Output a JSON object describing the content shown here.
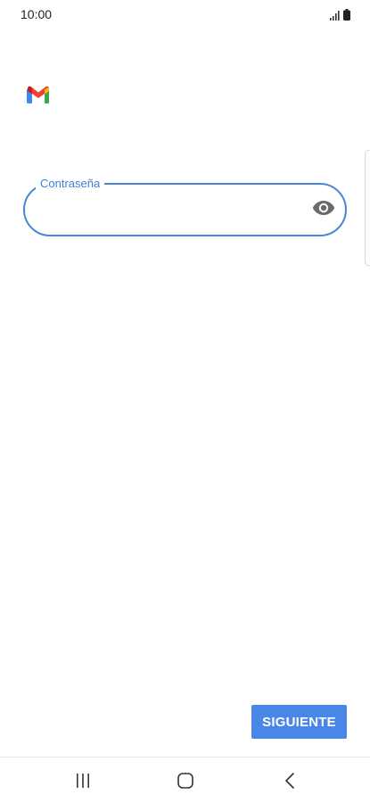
{
  "status_bar": {
    "time": "10:00",
    "icons": [
      "signal-icon",
      "battery-icon"
    ]
  },
  "app": {
    "logo": "gmail-logo-icon"
  },
  "password_field": {
    "label": "Contraseña",
    "value": "",
    "icon": "eye-icon"
  },
  "actions": {
    "next_label": "SIGUIENTE"
  },
  "nav_bar": {
    "icons": [
      "recents-icon",
      "home-icon",
      "back-icon"
    ]
  },
  "colors": {
    "accent": "#4a86e8",
    "field_border": "#4a86d8",
    "label": "#3f7ed8",
    "icon_gray": "#6b6b6b"
  }
}
